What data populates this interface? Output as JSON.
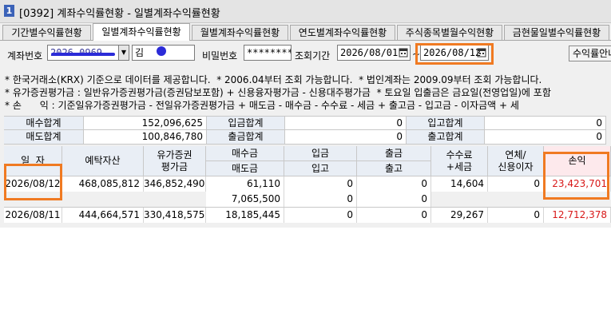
{
  "window": {
    "number": "1",
    "title": "[0392] 계좌수익률현황 - 일별계좌수익률현황"
  },
  "tabs": [
    {
      "label": "기간별수익률현황"
    },
    {
      "label": "일별계좌수익률현황"
    },
    {
      "label": "월별계좌수익률현황"
    },
    {
      "label": "연도별계좌수익률현황"
    },
    {
      "label": "주식종목별월수익현황"
    },
    {
      "label": "금현물일별수익률현황"
    }
  ],
  "filters": {
    "account_label": "계좌번호",
    "account_value": "2026-0969",
    "name_value": "김",
    "password_label": "비밀번호",
    "password_value": "********",
    "period_label": "조회기간",
    "start_date": "2026/08/01",
    "end_date": "2026/08/12",
    "range_sep": "~",
    "right_button": "수익률안내"
  },
  "notes": [
    "* 한국거래소(KRX) 기준으로 데이터를 제공합니다.  * 2006.04부터 조회 가능합니다.  * 법인계좌는 2009.09부터 조회 가능합니다.",
    "* 유가증권평가금 : 일반유가증권평가금(증권담보포함) + 신용융자평가금 - 신용대주평가금  * 토요일 입출금은 금요일(전영업일)에 포함",
    "* 손      익 : 기준일유가증권평가금 - 전일유가증권평가금 + 매도금 - 매수금 - 수수료 - 세금 + 출고금 - 입고금 - 이자금액 + 세"
  ],
  "summary": {
    "buy_total_label": "매수합계",
    "buy_total": "152,096,625",
    "sell_total_label": "매도합계",
    "sell_total": "100,846,780",
    "deposit_total_label": "입금합계",
    "deposit_total": "0",
    "withdraw_total_label": "출금합계",
    "withdraw_total": "0",
    "in_total_label": "입고합계",
    "in_total": "0",
    "out_total_label": "출고합계",
    "out_total": "0"
  },
  "grid": {
    "headers": {
      "date": "일  자",
      "deposit_assets": "예탁자산",
      "securities_eval": "유가증권\n평가금",
      "buy_amount": "매수금",
      "sell_amount": "매도금",
      "deposit": "입금",
      "in_goods": "입고",
      "withdraw": "출금",
      "out_goods": "출고",
      "fee_tax": "수수료\n+세금",
      "overdue_interest": "연체/\n신용이자",
      "profit": "손익"
    },
    "rows": [
      {
        "date": "2026/08/12",
        "deposit_assets": "468,085,812",
        "securities_eval": "346,852,490",
        "buy_amount": "61,110",
        "sell_amount": "7,065,500",
        "deposit": "0",
        "in_goods": "0",
        "withdraw": "0",
        "out_goods": "0",
        "fee_tax": "14,604",
        "overdue_interest": "0",
        "profit": "23,423,701"
      },
      {
        "date": "2026/08/11",
        "deposit_assets": "444,664,571",
        "securities_eval": "330,418,575",
        "buy_amount": "18,185,445",
        "deposit": "0",
        "withdraw": "0",
        "fee_tax": "29,267",
        "overdue_interest": "0",
        "profit": "12,712,378"
      }
    ]
  },
  "colors": {
    "highlight": "#f07a22",
    "loss_profit_red": "#d81818",
    "header_bg": "#e9eef5",
    "scribble": "#2b2bd8"
  }
}
